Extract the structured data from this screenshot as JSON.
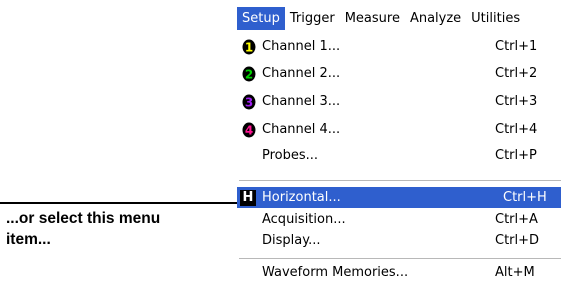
{
  "menubar": {
    "items": [
      "Setup",
      "Trigger",
      "Measure",
      "Analyze",
      "Utilities"
    ]
  },
  "menu": {
    "items": [
      {
        "label": "Channel 1...",
        "shortcut": "Ctrl+1",
        "icon": "channel-1-icon",
        "icon_number": "1",
        "icon_color": "#ffff00"
      },
      {
        "label": "Channel 2...",
        "shortcut": "Ctrl+2",
        "icon": "channel-2-icon",
        "icon_number": "2",
        "icon_color": "#00d000"
      },
      {
        "label": "Channel 3...",
        "shortcut": "Ctrl+3",
        "icon": "channel-3-icon",
        "icon_number": "3",
        "icon_color": "#a020f0"
      },
      {
        "label": "Channel 4...",
        "shortcut": "Ctrl+4",
        "icon": "channel-4-icon",
        "icon_number": "4",
        "icon_color": "#ff1493"
      },
      {
        "label": "Probes...",
        "shortcut": "Ctrl+P"
      },
      {
        "label": "Horizontal...",
        "shortcut": "Ctrl+H",
        "icon": "horizontal-icon",
        "icon_letter": "H"
      },
      {
        "label": "Acquisition...",
        "shortcut": "Ctrl+A"
      },
      {
        "label": "Display...",
        "shortcut": "Ctrl+D"
      },
      {
        "label": "Waveform Memories...",
        "shortcut": "Alt+M"
      }
    ]
  },
  "callout": {
    "text": "...or select this menu item..."
  },
  "colors": {
    "highlight": "#2f5fce",
    "highlight_text": "#ffffff",
    "separator": "#b8b8b8"
  }
}
